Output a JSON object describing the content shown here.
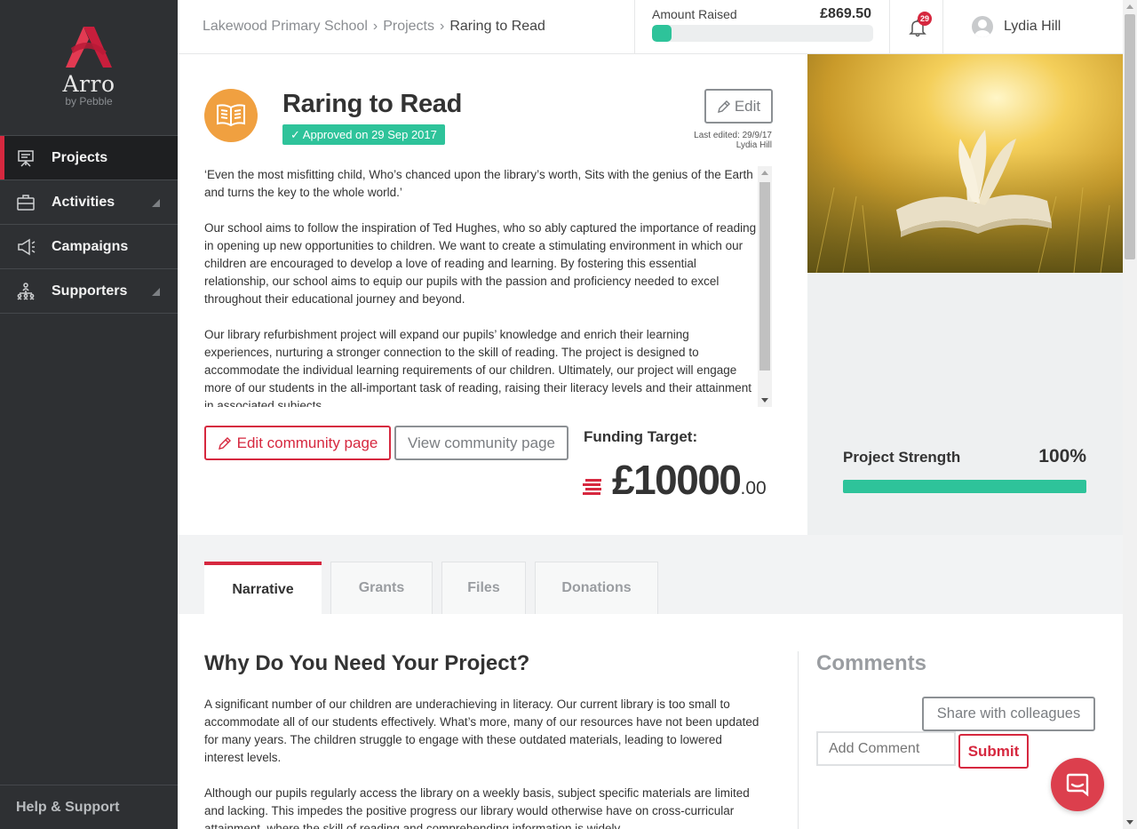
{
  "brand": {
    "name": "Arro",
    "sub": "by Pebble"
  },
  "sidebar": {
    "items": [
      {
        "label": "Projects"
      },
      {
        "label": "Activities"
      },
      {
        "label": "Campaigns"
      },
      {
        "label": "Supporters"
      }
    ],
    "help": "Help & Support"
  },
  "breadcrumb": {
    "school": "Lakewood Primary School",
    "projects": "Projects",
    "current": "Raring to Read",
    "sep": "›"
  },
  "amount": {
    "label": "Amount Raised",
    "value": "£869.50",
    "progress": 0.087
  },
  "notifications": {
    "count": "29"
  },
  "user": {
    "name": "Lydia Hill"
  },
  "project": {
    "title": "Raring to Read",
    "status": "Approved on 29 Sep 2017",
    "edit_label": "Edit",
    "last_edited_label": "Last edited: 29/9/17",
    "last_edited_by": "Lydia Hill",
    "description": [
      "‘Even the most misfitting child, Who’s chanced upon the library’s worth, Sits with the genius of the Earth and turns the key to the whole world.’",
      "Our school aims to follow the inspiration of Ted Hughes, who so ably captured the importance of reading in opening up new opportunities to children. We want to create a stimulating environment in which our children are encouraged to develop a love of reading and learning. By fostering this essential relationship, our school aims to equip our pupils with the passion and proficiency needed to excel throughout their educational journey and beyond.",
      "Our library refurbishment project will expand our pupils’ knowledge and enrich their learning experiences, nurturing a stronger connection to the skill of reading. The project is designed to accommodate the individual learning requirements of our children. Ultimately, our project will engage more of our students in the all-important task of reading, raising their literacy levels and their attainment in associated subjects."
    ],
    "edit_community": "Edit community page",
    "view_community": "View community page",
    "funding_label": "Funding Target:",
    "funding_main": "£10000",
    "funding_cents": ".00"
  },
  "strength": {
    "label": "Project Strength",
    "value": "100%",
    "progress": 1.0
  },
  "tabs": [
    {
      "label": "Narrative"
    },
    {
      "label": "Grants"
    },
    {
      "label": "Files"
    },
    {
      "label": "Donations"
    }
  ],
  "narrative": {
    "title": "Why Do You Need Your Project?",
    "paragraphs": [
      "A significant number of our children are underachieving in literacy. Our current library is too small to accommodate all of our students effectively. What’s more, many of our resources have not been updated for many years. The children struggle to engage with these outdated materials, leading to lowered interest levels.",
      "Although our pupils regularly access the library on a weekly basis, subject specific materials are limited and lacking. This impedes the positive progress our library would otherwise have on cross-curricular attainment, where the skill of reading and comprehending information is widely"
    ]
  },
  "comments": {
    "title": "Comments",
    "share": "Share with colleagues",
    "placeholder": "Add Comment",
    "submit": "Submit"
  },
  "colors": {
    "accent": "#d6283f",
    "success": "#2ec39a",
    "sidebar": "#2e3033",
    "project_icon": "#f0a040"
  }
}
